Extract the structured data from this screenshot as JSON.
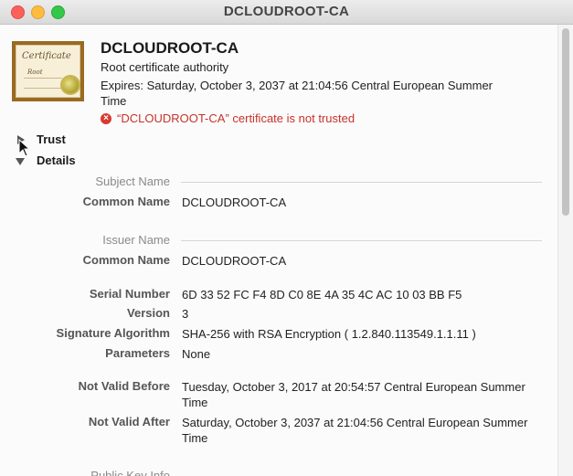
{
  "window": {
    "title": "DCLOUDROOT-CA"
  },
  "header": {
    "icon_script": "Certificate",
    "icon_subtext": "Root",
    "name": "DCLOUDROOT-CA",
    "kind": "Root certificate authority",
    "expires": "Expires: Saturday, October 3, 2037 at 21:04:56 Central European Summer Time",
    "status": "“DCLOUDROOT-CA” certificate is not trusted",
    "status_color": "#c8322b"
  },
  "sections": {
    "trust_label": "Trust",
    "details_label": "Details"
  },
  "details": {
    "subject_name_head": "Subject Name",
    "subject_common_name_label": "Common Name",
    "subject_common_name": "DCLOUDROOT-CA",
    "issuer_name_head": "Issuer Name",
    "issuer_common_name_label": "Common Name",
    "issuer_common_name": "DCLOUDROOT-CA",
    "serial_label": "Serial Number",
    "serial": "6D 33 52 FC F4 8D C0 8E 4A 35 4C AC 10 03 BB F5",
    "version_label": "Version",
    "version": "3",
    "sigalg_label": "Signature Algorithm",
    "sigalg": "SHA-256 with RSA Encryption ( 1.2.840.113549.1.1.11 )",
    "params_label": "Parameters",
    "params": "None",
    "not_before_label": "Not Valid Before",
    "not_before": "Tuesday, October 3, 2017 at 20:54:57 Central European Summer Time",
    "not_after_label": "Not Valid After",
    "not_after": "Saturday, October 3, 2037 at 21:04:56 Central European Summer Time",
    "public_key_head": "Public Key Info"
  }
}
